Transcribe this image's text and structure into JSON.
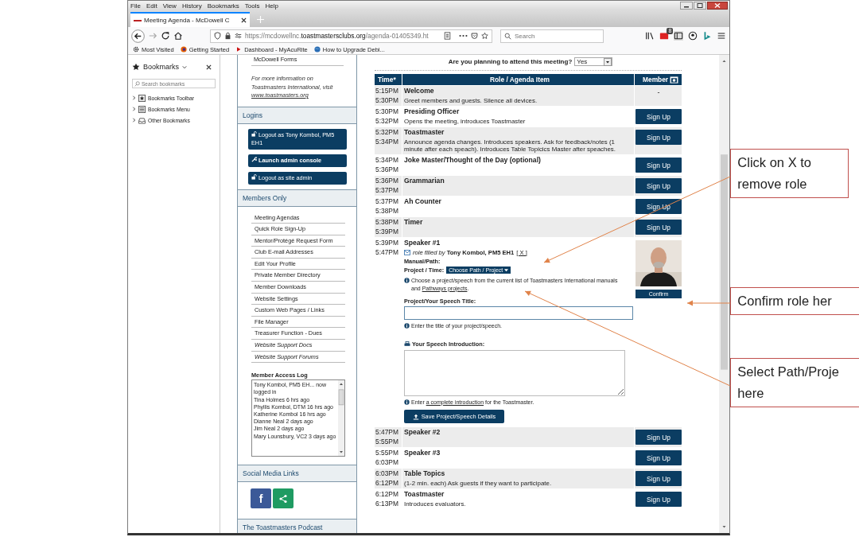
{
  "menu_bar": [
    "File",
    "Edit",
    "View",
    "History",
    "Bookmarks",
    "Tools",
    "Help"
  ],
  "tabs": [
    {
      "label": "Meeting Agenda - McDowell C",
      "selected": true
    }
  ],
  "address": {
    "url_start": "https://mcdowellnc.",
    "url_domain": "toastmastersclubs.org",
    "url_end": "/agenda-01405349.ht"
  },
  "search": {
    "placeholder": "Search"
  },
  "toolbar_badge": "8",
  "bookmarks_bar": [
    {
      "label": "Most Visited",
      "kind": "gear"
    },
    {
      "label": "Getting Started",
      "kind": "firefox"
    },
    {
      "label": "Dashboard - MyAcuRite",
      "kind": "flag"
    },
    {
      "label": "How to Upgrade Debi...",
      "kind": "globe"
    }
  ],
  "bookmarks_sidebar": {
    "title": "Bookmarks",
    "search_placeholder": "Search bookmarks",
    "items": [
      {
        "label": "Bookmarks Toolbar",
        "kind": "toolbar",
        "expanded": false
      },
      {
        "label": "Bookmarks Menu",
        "kind": "menu",
        "expanded": false
      },
      {
        "label": "Other Bookmarks",
        "kind": "folder",
        "expanded": false
      }
    ]
  },
  "left_column": {
    "top_link": "McDowell Forms",
    "info": {
      "text": "For more information on Toastmasters International, visit",
      "link": "www.toastmasters.org"
    },
    "sections": [
      {
        "title": "Logins",
        "kind": "buttons",
        "buttons": [
          {
            "label": "Logout as Tony Kombol, PM5 EH1",
            "kind": "lock"
          },
          {
            "label": "Launch admin console",
            "kind": "wrench"
          },
          {
            "label": "Logout as site admin",
            "kind": "lock"
          }
        ]
      },
      {
        "title": "Members Only",
        "kind": "links",
        "links": [
          {
            "label": "Meeting Agendas",
            "italic": false
          },
          {
            "label": "Quick Role Sign-Up",
            "italic": false
          },
          {
            "label": "Mentor/Protégé Request Form",
            "italic": false
          },
          {
            "label": "Club E-mail Addresses",
            "italic": false
          },
          {
            "label": "Edit Your Profile",
            "italic": false
          },
          {
            "label": "Private Member Directory",
            "italic": false
          },
          {
            "label": "Member Downloads",
            "italic": false
          },
          {
            "label": "Website Settings",
            "italic": false
          },
          {
            "label": "Custom Web Pages / Links",
            "italic": false
          },
          {
            "label": "File Manager",
            "italic": false
          },
          {
            "label": "Treasurer Function - Dues",
            "italic": false
          },
          {
            "label": "Website Support Docs",
            "italic": true
          },
          {
            "label": "Website Support Forums",
            "italic": true
          }
        ],
        "log": {
          "title": "Member Access Log",
          "entries": [
            "Tony Kombol, PM5 EH... now logged in",
            "Tina Holmes 6 hrs ago",
            "Phyllis Kombol, DTM 16 hrs ago",
            "Katherine Kombol 16 hrs ago",
            "Dianne Neal 2 days ago",
            "Jim Neal 2 days ago",
            "Mary Lounsbury, VC2 3 days ago"
          ]
        }
      },
      {
        "title": "Social Media Links",
        "kind": "social",
        "icons": [
          {
            "kind": "facebook",
            "glyph": "f"
          },
          {
            "kind": "share"
          }
        ]
      },
      {
        "title": "The Toastmasters Podcast",
        "kind": "plain"
      }
    ]
  },
  "attend": {
    "question": "Are you planning to attend this meeting?",
    "value": "Yes"
  },
  "agenda": {
    "columns": [
      "Time*",
      "Role / Agenda Item",
      "Member"
    ],
    "rows": [
      {
        "start": "5:15PM",
        "end": "5:30PM",
        "role": "Welcome",
        "description": "Greet members and guests.  Silence all devices.",
        "member": {
          "kind": "none",
          "text": "-"
        }
      },
      {
        "start": "5:30PM",
        "end": "5:32PM",
        "role": "Presiding Officer",
        "description": "Opens the meeting, introduces Toastmaster",
        "member": {
          "kind": "signup",
          "label": "Sign Up"
        }
      },
      {
        "start": "5:32PM",
        "end": "5:34PM",
        "role": "Toastmaster",
        "description": "Announce agenda changes. Introduces speakers. Ask for feedback/notes (1 minute after each speach). Introduces Table Topicics Master after speaches.",
        "member": {
          "kind": "signup",
          "label": "Sign Up"
        }
      },
      {
        "start": "5:34PM",
        "end": "5:36PM",
        "role": "Joke Master/Thought of the Day (optional)",
        "member": {
          "kind": "signup",
          "label": "Sign Up"
        }
      },
      {
        "start": "5:36PM",
        "end": "5:37PM",
        "role": "Grammarian",
        "member": {
          "kind": "signup",
          "label": "Sign Up"
        }
      },
      {
        "start": "5:37PM",
        "end": "5:38PM",
        "role": "Ah Counter",
        "member": {
          "kind": "signup",
          "label": "Sign Up"
        }
      },
      {
        "start": "5:38PM",
        "end": "5:39PM",
        "role": "Timer",
        "member": {
          "kind": "signup",
          "label": "Sign Up"
        }
      },
      {
        "start": "5:39PM",
        "end": "5:47PM",
        "role": "Speaker #1",
        "member": {
          "kind": "filled",
          "label": "Confirm"
        },
        "details": {
          "filled_prefix": "role filled by",
          "member_name": "Tony Kombol, PM5 EH1",
          "remove_link": "[ X ]",
          "manual_label": "Manual/Path:",
          "project_label": "Project / Time:",
          "project_button": "Choose Path / Project",
          "project_hint": {
            "before": "Choose a project/speech from the current list of Toastmasters International manuals and ",
            "link": "Pathways projects",
            "after": "."
          },
          "title_label": "Project/Your Speech Title:",
          "title_hint": "Enter the title of your project/speech.",
          "intro_label": "Your Speech Introduction:",
          "intro_hint": {
            "before": "Enter ",
            "link": "a complete introduction",
            "after": " for the Toastmaster."
          },
          "save_button": "Save Project/Speech Details"
        }
      },
      {
        "start": "5:47PM",
        "end": "5:55PM",
        "role": "Speaker #2",
        "member": {
          "kind": "signup",
          "label": "Sign Up"
        }
      },
      {
        "start": "5:55PM",
        "end": "6:03PM",
        "role": "Speaker #3",
        "member": {
          "kind": "signup",
          "label": "Sign Up"
        }
      },
      {
        "start": "6:03PM",
        "end": "6:12PM",
        "role": "Table Topics",
        "description": "(1-2 min. each) Ask guests if they want to participate.",
        "member": {
          "kind": "signup",
          "label": "Sign Up"
        }
      },
      {
        "start": "6:12PM",
        "end": "6:13PM",
        "role": "Toastmaster",
        "description": "Introduces evaluators.",
        "member": {
          "kind": "signup",
          "label": "Sign Up"
        }
      }
    ]
  },
  "callouts": [
    {
      "lines": [
        "Click on X to",
        "remove role"
      ]
    },
    {
      "lines": [
        "Confirm role her"
      ]
    },
    {
      "lines": [
        "Select Path/Proje",
        "here"
      ]
    }
  ]
}
